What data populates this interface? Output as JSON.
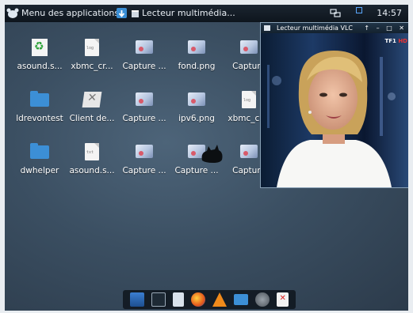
{
  "panel": {
    "menu_label": "Menu des applications",
    "task_label": "Lecteur multimédia...",
    "clock": "14:57"
  },
  "desktop": {
    "icons": [
      {
        "label": "asound.s...",
        "icon": "recycle-icon"
      },
      {
        "label": "xbmc_cr...",
        "icon": "log-file-icon"
      },
      {
        "label": "Capture ...",
        "icon": "image-icon"
      },
      {
        "label": "fond.png",
        "icon": "image-icon"
      },
      {
        "label": "Capture",
        "icon": "image-icon"
      },
      {
        "label": "ldrevontest",
        "icon": "folder-icon"
      },
      {
        "label": "Client de...",
        "icon": "tools-icon"
      },
      {
        "label": "Capture ...",
        "icon": "image-icon"
      },
      {
        "label": "ipv6.png",
        "icon": "image-icon"
      },
      {
        "label": "xbmc_cr...",
        "icon": "log-file-icon"
      },
      {
        "label": "dwhelper",
        "icon": "folder-icon"
      },
      {
        "label": "asound.s...",
        "icon": "text-file-icon"
      },
      {
        "label": "Capture ...",
        "icon": "image-icon"
      },
      {
        "label": "Capture ...",
        "icon": "image-icon"
      },
      {
        "label": "Capture",
        "icon": "image-icon"
      }
    ]
  },
  "vlc": {
    "title": "Lecteur multimédia VLC",
    "controls": "↑ – □ ✕",
    "channel_logo_a": "TF1",
    "channel_logo_b": "HD"
  },
  "dock": {
    "items": [
      "desktop-icon",
      "terminal-icon",
      "notepad-icon",
      "firefox-icon",
      "vlc-icon",
      "file-manager-icon",
      "disk-icon",
      "pdf-icon"
    ]
  },
  "colors": {
    "panel": "#0e151d",
    "accent": "#3c8fd6"
  }
}
